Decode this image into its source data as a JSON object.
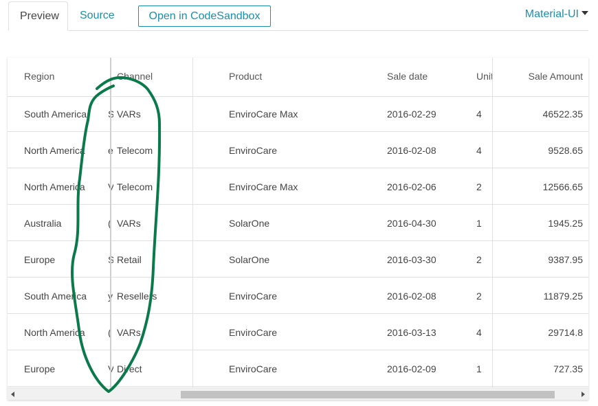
{
  "tabs": {
    "preview": "Preview",
    "source": "Source"
  },
  "open_button": "Open in CodeSandbox",
  "theme_select": {
    "value": "Material-UI",
    "icon": "caret-down-icon"
  },
  "grid": {
    "columns": [
      "Region",
      "Channel",
      "Product",
      "Sale date",
      "Unit",
      "Sale Amount"
    ],
    "rows": [
      {
        "region": "South America",
        "ghost": "S",
        "channel": "VARs",
        "product": "EnviroCare Max",
        "date": "2016-02-29",
        "units": "4",
        "amount": "46522.35"
      },
      {
        "region": "North America",
        "ghost": "e",
        "channel": "Telecom",
        "product": "EnviroCare",
        "date": "2016-02-08",
        "units": "4",
        "amount": "9528.65"
      },
      {
        "region": "North America",
        "ghost": "V",
        "channel": "Telecom",
        "product": "EnviroCare Max",
        "date": "2016-02-06",
        "units": "2",
        "amount": "12566.65"
      },
      {
        "region": "Australia",
        "ghost": "(",
        "channel": "VARs",
        "product": "SolarOne",
        "date": "2016-04-30",
        "units": "1",
        "amount": "1945.25"
      },
      {
        "region": "Europe",
        "ghost": "S",
        "channel": "Retail",
        "product": "SolarOne",
        "date": "2016-03-30",
        "units": "2",
        "amount": "9387.95"
      },
      {
        "region": "South America",
        "ghost": "y",
        "channel": "Resellers",
        "product": "EnviroCare",
        "date": "2016-02-08",
        "units": "2",
        "amount": "11879.25"
      },
      {
        "region": "North America",
        "ghost": "(",
        "channel": "VARs",
        "product": "EnviroCare",
        "date": "2016-03-13",
        "units": "4",
        "amount": "29714.8"
      },
      {
        "region": "Europe",
        "ghost": "V",
        "channel": "Direct",
        "product": "EnviroCare",
        "date": "2016-02-09",
        "units": "1",
        "amount": "727.35"
      }
    ]
  },
  "scrollbar": {
    "left_icon": "arrow-left-icon",
    "right_icon": "arrow-right-icon"
  },
  "colors": {
    "accent": "#1a8fb0",
    "annotation": "#0a7a4a"
  }
}
